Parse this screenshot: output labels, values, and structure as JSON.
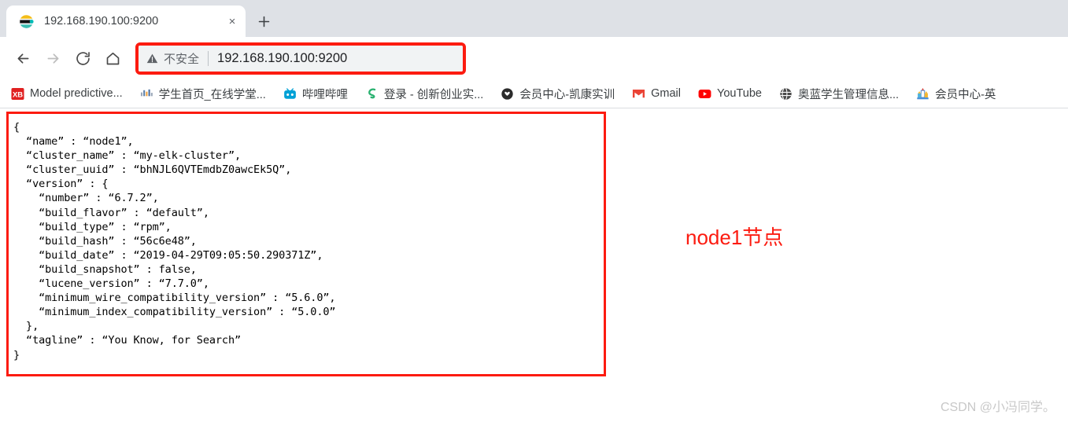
{
  "browser": {
    "tab": {
      "title": "192.168.190.100:9200",
      "favicon": "elasticsearch-icon",
      "close_label": "×"
    },
    "new_tab_label": "+",
    "nav": {
      "back": "←",
      "forward": "→",
      "reload": "↻",
      "home": "⌂"
    },
    "omnibox": {
      "security_icon": "warning-triangle-icon",
      "security_label": "不安全",
      "url": "192.168.190.100:9200",
      "highlight_color": "#fc1b10"
    },
    "bookmarks": [
      {
        "label": "Model predictive...",
        "icon": "xb-red-square-icon"
      },
      {
        "label": "学生首页_在线学堂...",
        "icon": "bars-chart-icon"
      },
      {
        "label": "哔哩哔哩",
        "icon": "bilibili-tv-icon"
      },
      {
        "label": "登录 - 创新创业实...",
        "icon": "green-s-logo-icon"
      },
      {
        "label": "会员中心-凯康实训",
        "icon": "dark-circle-icon"
      },
      {
        "label": "Gmail",
        "icon": "gmail-icon"
      },
      {
        "label": "YouTube",
        "icon": "youtube-icon"
      },
      {
        "label": "奥蓝学生管理信息...",
        "icon": "globe-dark-icon"
      },
      {
        "label": "会员中心-英",
        "icon": "castle-icon"
      }
    ]
  },
  "content": {
    "json_response": "{\n  “name” : “node1”,\n  “cluster_name” : “my-elk-cluster”,\n  “cluster_uuid” : “bhNJL6QVTEmdbZ0awcEk5Q”,\n  “version” : {\n    “number” : “6.7.2”,\n    “build_flavor” : “default”,\n    “build_type” : “rpm”,\n    “build_hash” : “56c6e48”,\n    “build_date” : “2019-04-29T09:05:50.290371Z”,\n    “build_snapshot” : false,\n    “lucene_version” : “7.7.0”,\n    “minimum_wire_compatibility_version” : “5.6.0”,\n    “minimum_index_compatibility_version” : “5.0.0”\n  },\n  “tagline” : “You Know, for Search”\n}",
    "fields": {
      "name": "node1",
      "cluster_name": "my-elk-cluster",
      "cluster_uuid": "bhNJL6QVTEmdbZ0awcEk5Q",
      "version_number": "6.7.2",
      "build_flavor": "default",
      "build_type": "rpm",
      "build_hash": "56c6e48",
      "build_date": "2019-04-29T09:05:50.290371Z",
      "build_snapshot": "false",
      "lucene_version": "7.7.0",
      "minimum_wire_compatibility_version": "5.6.0",
      "minimum_index_compatibility_version": "5.0.0",
      "tagline": "You Know, for Search"
    },
    "annotation": "node1节点",
    "annotation_color": "#fc1b10",
    "watermark": "CSDN @小冯同学。"
  }
}
